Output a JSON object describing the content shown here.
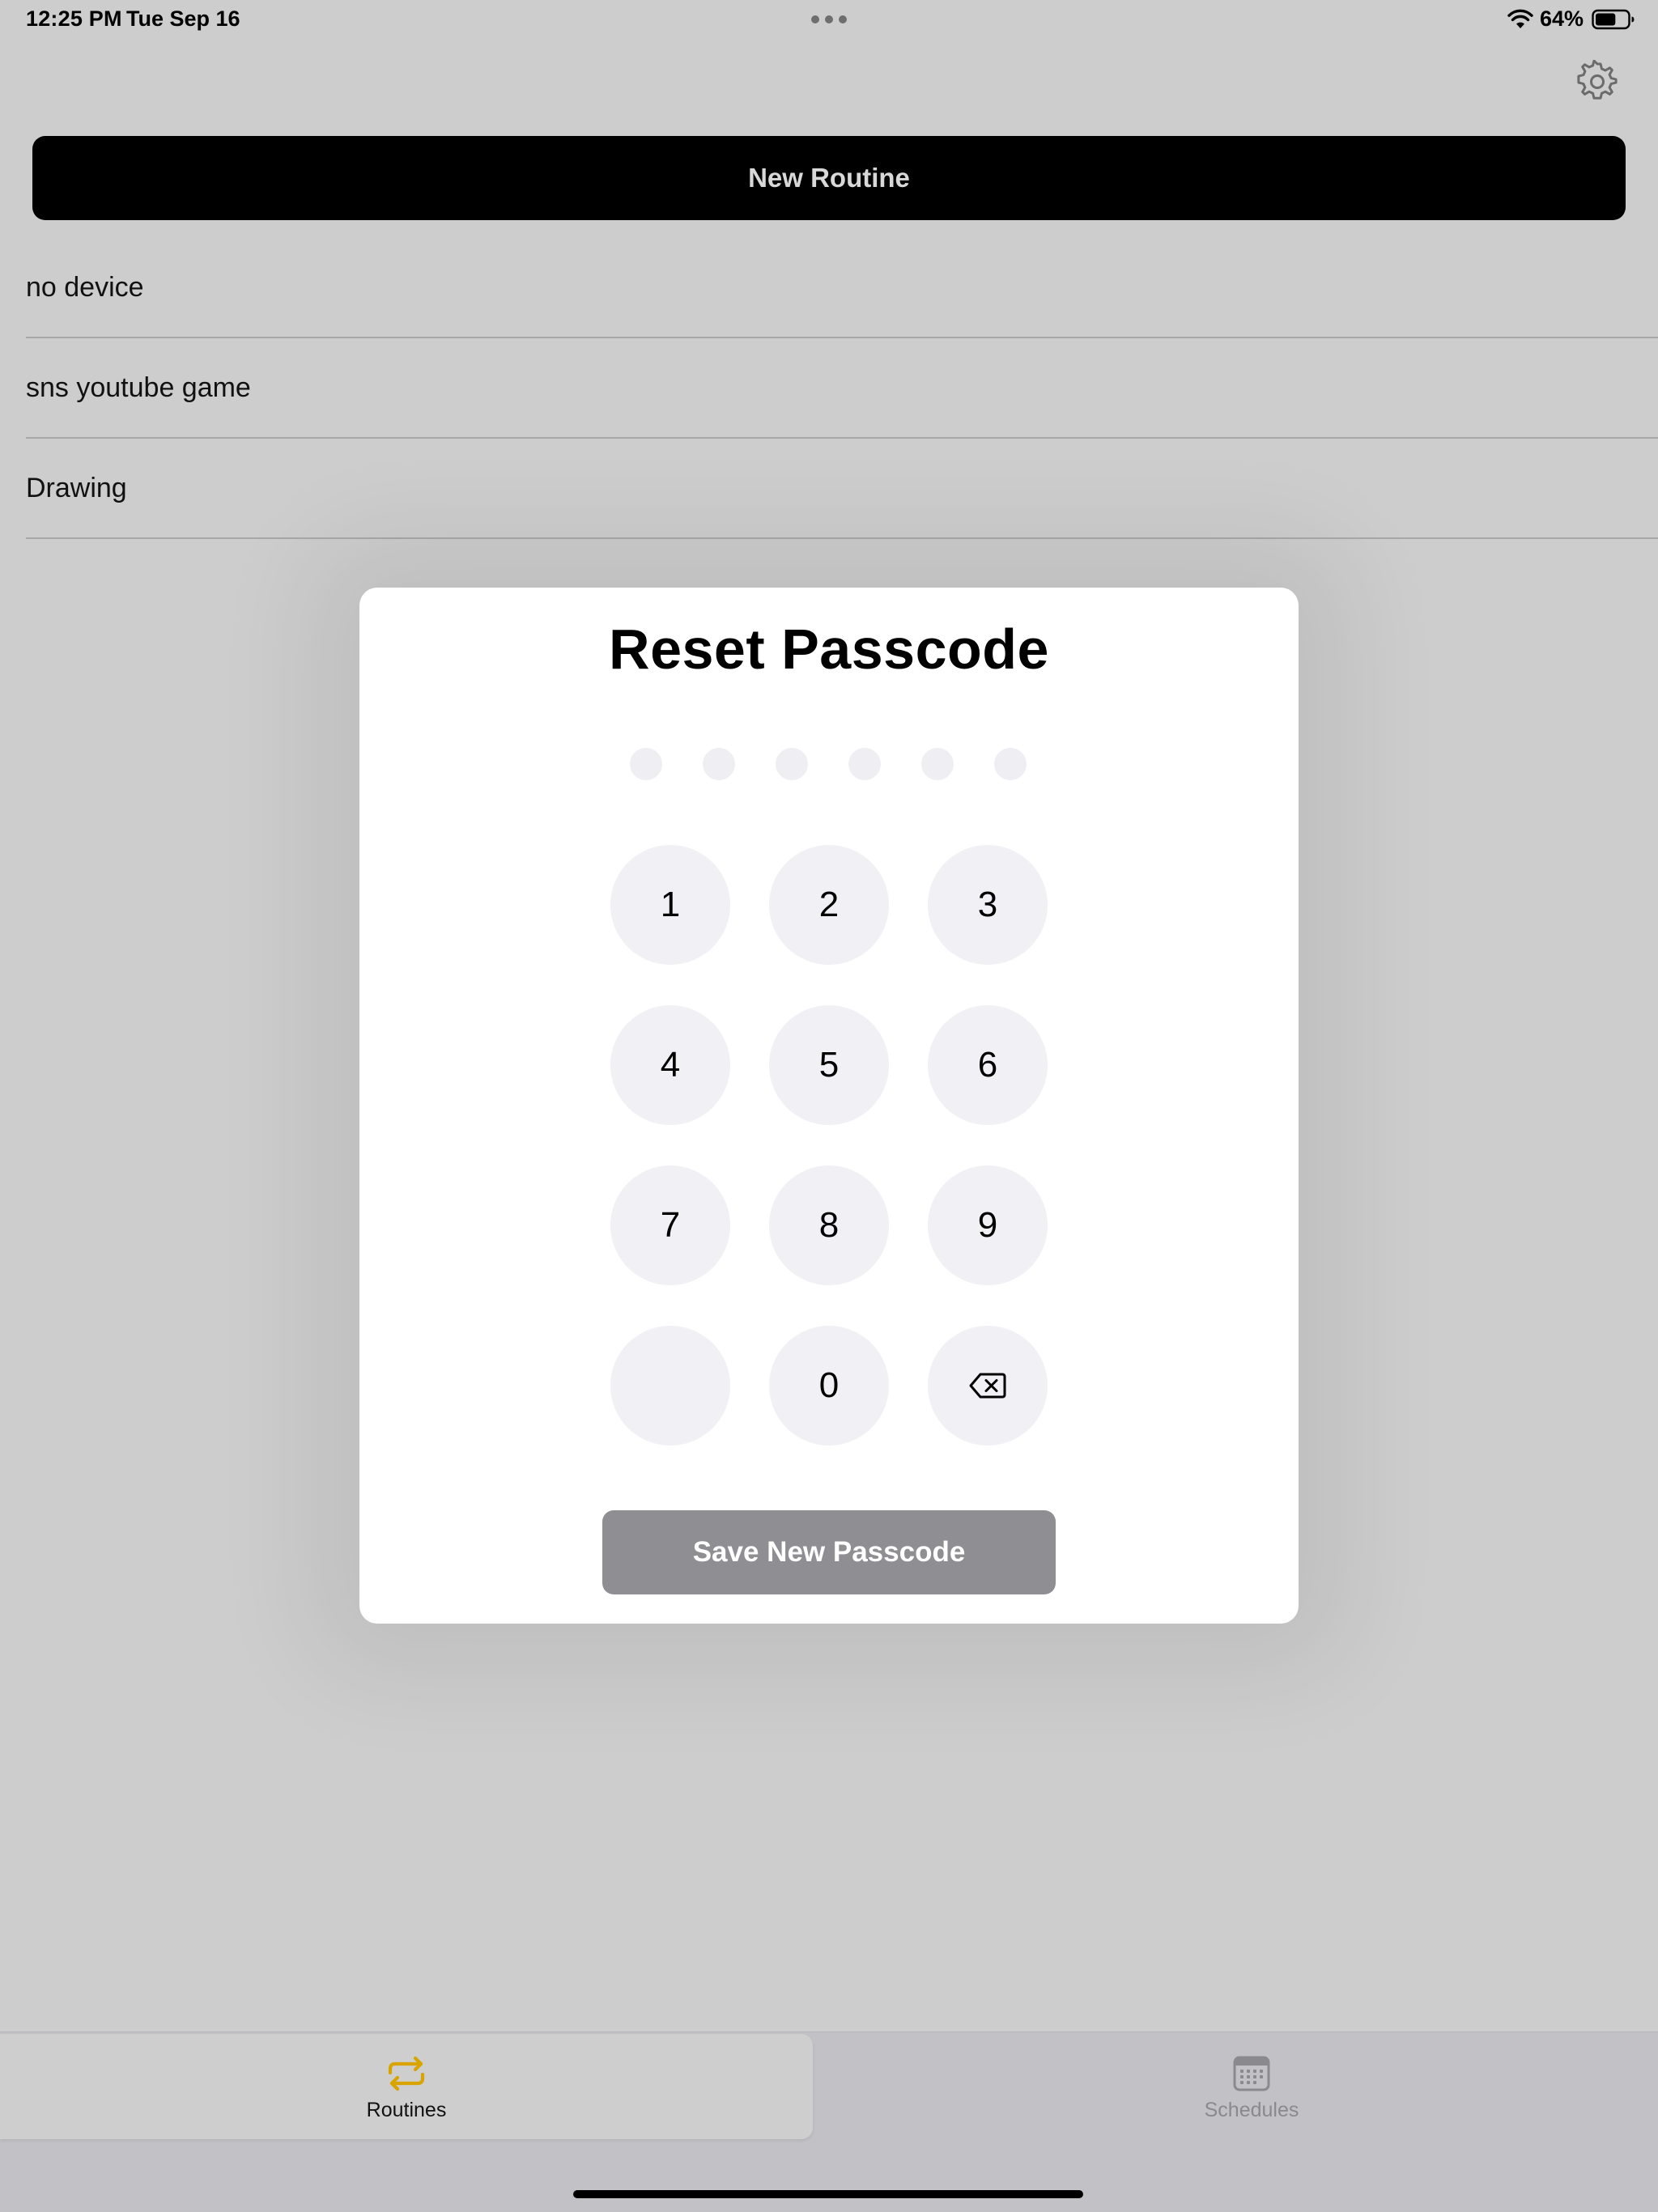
{
  "status_bar": {
    "time": "12:25 PM",
    "date": "Tue Sep 16",
    "battery_percent": "64%",
    "battery_level": 0.64,
    "icons": [
      "multitask-dots-icon",
      "wifi-icon",
      "battery-icon"
    ]
  },
  "toolbar": {
    "settings_icon": "gear-icon",
    "new_routine_label": "New Routine"
  },
  "routines": [
    {
      "name": "no device"
    },
    {
      "name": "sns youtube game"
    },
    {
      "name": "Drawing"
    }
  ],
  "modal": {
    "title": "Reset Passcode",
    "pin_length": 6,
    "pin_entered": 0,
    "keys": [
      "1",
      "2",
      "3",
      "4",
      "5",
      "6",
      "7",
      "8",
      "9",
      "",
      "0",
      "delete-icon"
    ],
    "save_label": "Save New Passcode"
  },
  "tab_bar": {
    "tabs": [
      {
        "label": "Routines",
        "icon": "repeat-arrows-icon",
        "selected": true
      },
      {
        "label": "Schedules",
        "icon": "calendar-icon",
        "selected": false
      }
    ]
  },
  "colors": {
    "background": "#cdcdcd",
    "primary_button": "#000000",
    "accent": "#d9a400",
    "keypad_key": "#f0f0f5",
    "save_button_disabled": "#8e8e93",
    "tab_inactive": "#8a8a8e"
  }
}
